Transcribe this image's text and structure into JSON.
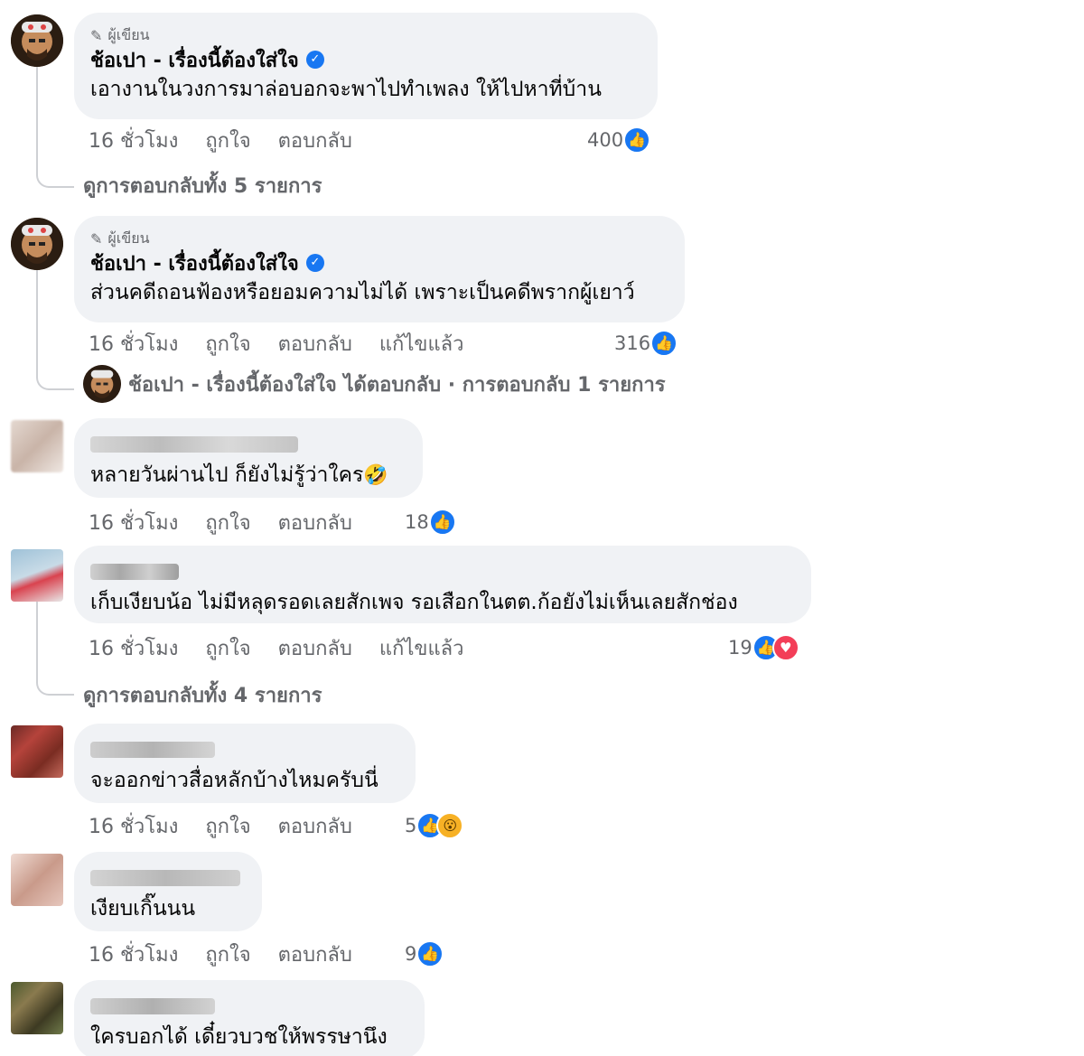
{
  "author": {
    "badge": "ผู้เขียน",
    "name": "ช้อเปา - เรื่องนี้ต้องใส่ใจ"
  },
  "actions": {
    "time": "16 ชั่วโมง",
    "like": "ถูกใจ",
    "reply": "ตอบกลับ",
    "edited": "แก้ไขแล้ว"
  },
  "comments": [
    {
      "text": "เอางานในวงการมาล่อบอกจะพาไปทำเพลง ให้ไปหาที่บ้าน",
      "reactions": "400",
      "view_replies": "ดูการตอบกลับทั้ง 5 รายการ"
    },
    {
      "text": "ส่วนคดีถอนฟ้องหรือยอมความไม่ได้ เพราะเป็นคดีพรากผู้เยาว์",
      "reactions": "316",
      "reply_preview": "ช้อเปา - เรื่องนี้ต้องใส่ใจ ได้ตอบกลับ · การตอบกลับ 1 รายการ"
    },
    {
      "text": "หลายวันผ่านไป ก็ยังไม่รู้ว่าใคร",
      "emoji": "🤣",
      "reactions": "18"
    },
    {
      "text": "เก็บเงียบน้อ ไม่มีหลุดรอดเลยสักเพจ รอเสือกในตต.ก้อยังไม่เห็นเลยสักช่อง",
      "reactions": "19",
      "view_replies": "ดูการตอบกลับทั้ง 4 รายการ"
    },
    {
      "text": "จะออกข่าวสื่อหลักบ้างไหมครับนี่",
      "reactions": "5"
    },
    {
      "text": "เงียบเกิ๊นนน",
      "reactions": "9"
    },
    {
      "text": "ใครบอกได้ เดี๋ยวบวชให้พรรษานึง"
    }
  ],
  "icons": {
    "pencil": "pencil-icon",
    "verified": "verified-check-icon",
    "like": "like-thumb-icon",
    "love": "love-heart-icon",
    "wow": "wow-face-icon"
  },
  "colors": {
    "like_blue": "#1877f2",
    "bubble_bg": "#f0f2f5",
    "meta_gray": "#65676b"
  }
}
